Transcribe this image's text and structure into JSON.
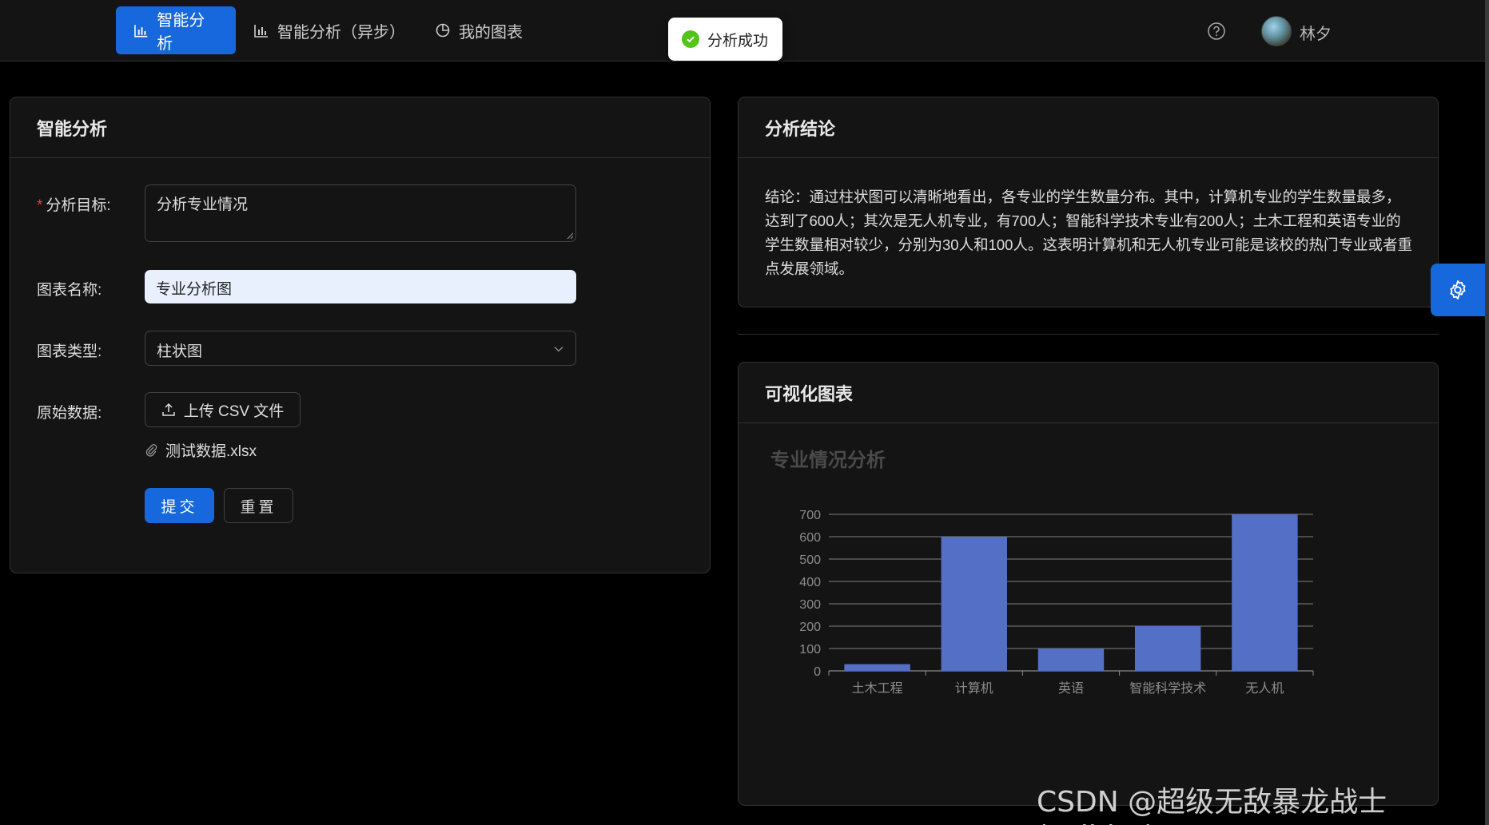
{
  "nav": {
    "tabs": [
      {
        "label": "智能分析",
        "icon": "bar-chart-icon"
      },
      {
        "label": "智能分析（异步）",
        "icon": "bar-chart-icon"
      },
      {
        "label": "我的图表",
        "icon": "pie-chart-icon"
      }
    ],
    "user_name": "林夕"
  },
  "toast": {
    "message": "分析成功",
    "color": "#52c41a"
  },
  "form_card": {
    "title": "智能分析",
    "goal_label": "分析目标:",
    "goal_required_mark": "*",
    "goal_value": "分析专业情况",
    "chart_name_label": "图表名称:",
    "chart_name_value": "专业分析图",
    "chart_type_label": "图表类型:",
    "chart_type_value": "柱状图",
    "raw_data_label": "原始数据:",
    "upload_label": "上传 CSV 文件",
    "file_name": "测试数据.xlsx",
    "submit_label": "提交",
    "reset_label": "重置"
  },
  "conclusion_card": {
    "title": "分析结论",
    "text": "结论：通过柱状图可以清晰地看出，各专业的学生数量分布。其中，计算机专业的学生数量最多，达到了600人；其次是无人机专业，有700人；智能科学技术专业有200人；土木工程和英语专业的学生数量相对较少，分别为30人和100人。这表明计算机和无人机专业可能是该校的热门专业或者重点发展领域。"
  },
  "chart_card": {
    "title": "可视化图表"
  },
  "chart_data": {
    "type": "bar",
    "title": "专业情况分析",
    "categories": [
      "土木工程",
      "计算机",
      "英语",
      "智能科学技术",
      "无人机"
    ],
    "values": [
      30,
      600,
      100,
      200,
      700
    ],
    "ylim": [
      0,
      700
    ],
    "yticks": [
      "0",
      "100",
      "200",
      "300",
      "400",
      "500",
      "600",
      "700"
    ],
    "bar_color": "#5470c6",
    "grid": true
  },
  "watermark": "CSDN @超级无敌暴龙战士(solider)",
  "colors": {
    "primary": "#1668dc",
    "background": "#000000",
    "card": "#141414"
  }
}
